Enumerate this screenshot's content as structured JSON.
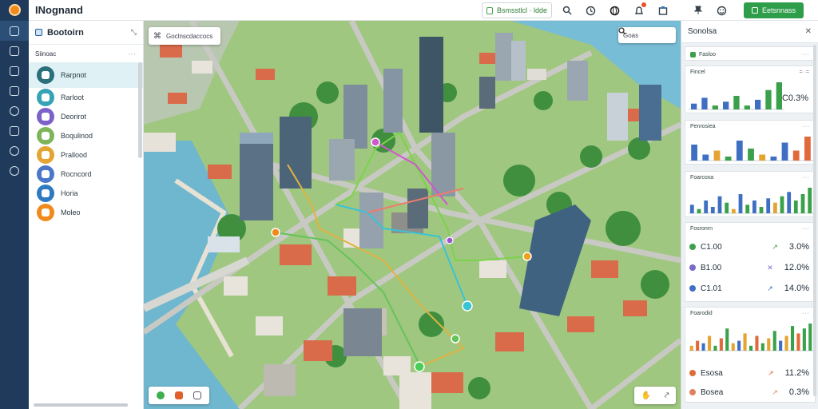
{
  "app": {
    "title": "INognand"
  },
  "topbar": {
    "search_label": "Bsmsstlcl · ldde",
    "cta_label": "Eetsnnass",
    "icons": [
      "search-icon",
      "history-icon",
      "globe-icon",
      "notification-icon",
      "share-icon",
      "pin-icon",
      "smiley-icon"
    ],
    "colors": {
      "brand": "#1f3a5a",
      "accent": "#f08a1c",
      "cta": "#2e9e4a"
    }
  },
  "rail": {
    "icons": [
      "edit-icon",
      "layers-icon",
      "document-icon",
      "files-icon",
      "analytics-icon",
      "tools-icon",
      "explore-icon",
      "info-icon"
    ]
  },
  "left_panel": {
    "title": "Bootoirn",
    "subtitle": "Siinoac",
    "more": "···",
    "layers": [
      {
        "label": "Rarpnot",
        "color": "#2a6f7c"
      },
      {
        "label": "Rarloot",
        "color": "#35a3b5"
      },
      {
        "label": "Deorirot",
        "color": "#7b61c9"
      },
      {
        "label": "Boqulinod",
        "color": "#7fb55a"
      },
      {
        "label": "Prallood",
        "color": "#e5a331"
      },
      {
        "label": "Rocncord",
        "color": "#4a77c9"
      },
      {
        "label": "Horia",
        "color": "#2d7ac0"
      },
      {
        "label": "Moleo",
        "color": "#f08a1c"
      }
    ]
  },
  "map": {
    "search_text": "Goclnscdaccocs",
    "search2_text": "Goas",
    "tool_icons": [
      "marker-green-icon",
      "marker-orange-icon",
      "comment-icon"
    ],
    "tool2_icons": [
      "pan-icon",
      "measure-icon"
    ]
  },
  "right_panel": {
    "title": "Sonolsa",
    "top_row": {
      "label": "Fasloo",
      "more": "···"
    },
    "cards": [
      {
        "title": "Fincel",
        "value": "C0.3%",
        "more": "=·="
      },
      {
        "title": "Penrosiea",
        "more": "···"
      },
      {
        "title": "Foarcoxa",
        "more": "···"
      },
      {
        "title": "Foaroadd",
        "more": "···"
      }
    ],
    "kpi_title": "Fosronrn",
    "kpi_more": "···",
    "kpis": [
      {
        "label": "C1.00",
        "value": "3.0%",
        "color": "#3aa14a"
      },
      {
        "label": "B1.00",
        "value": "12.0%",
        "color": "#7a6cc9"
      },
      {
        "label": "C1.01",
        "value": "14.0%",
        "color": "#3f6fc2"
      }
    ],
    "lower_title": "Foarodid",
    "lower_more": "···",
    "bottom_kpis": [
      {
        "label": "Esosa",
        "value": "11.2%",
        "color": "#e06a3a"
      },
      {
        "label": "Bosea",
        "value": "0.3%",
        "color": "#e08060"
      }
    ]
  },
  "chart_data": [
    {
      "type": "bar",
      "title": "Fincel",
      "values": [
        3,
        6,
        2,
        4,
        7,
        2,
        5,
        10,
        14
      ],
      "colors": [
        "#3f6fc2",
        "#3f6fc2",
        "#3aa14a",
        "#3f6fc2",
        "#3aa14a",
        "#3aa14a",
        "#3f6fc2",
        "#3aa14a",
        "#3aa14a"
      ]
    },
    {
      "type": "bar",
      "title": "Penrosiea",
      "values": [
        8,
        3,
        5,
        2,
        10,
        6,
        3,
        2,
        9,
        5,
        12
      ],
      "colors": [
        "#3f6fc2",
        "#3f6fc2",
        "#e5a331",
        "#3aa14a",
        "#3f6fc2",
        "#3aa14a",
        "#e5a331",
        "#3f6fc2",
        "#3f6fc2",
        "#e06a3a",
        "#e06a3a"
      ]
    },
    {
      "type": "bar",
      "title": "Foarcoxa",
      "values": [
        4,
        2,
        6,
        3,
        8,
        5,
        2,
        9,
        4,
        6,
        3,
        7,
        5,
        8,
        10,
        6,
        9,
        12
      ],
      "colors": [
        "#3f6fc2",
        "#3aa14a",
        "#3f6fc2",
        "#3f6fc2",
        "#3f6fc2",
        "#3aa14a",
        "#e5a331",
        "#3f6fc2",
        "#3aa14a",
        "#3f6fc2",
        "#3aa14a",
        "#3f6fc2",
        "#e5a331",
        "#3aa14a",
        "#3f6fc2",
        "#3aa14a",
        "#3aa14a",
        "#3aa14a"
      ]
    },
    {
      "type": "bar",
      "title": "Foarodid",
      "values": [
        2,
        4,
        3,
        6,
        2,
        5,
        9,
        3,
        4,
        7,
        2,
        6,
        3,
        5,
        8,
        4,
        6,
        10,
        7,
        9,
        11
      ],
      "colors": [
        "#e5a331",
        "#e06a3a",
        "#3f6fc2",
        "#e5a331",
        "#3aa14a",
        "#e06a3a",
        "#3aa14a",
        "#e5a331",
        "#3f6fc2",
        "#e5a331",
        "#3aa14a",
        "#e06a3a",
        "#3aa14a",
        "#e5a331",
        "#3aa14a",
        "#3f6fc2",
        "#e5a331",
        "#3aa14a",
        "#e06a3a",
        "#3aa14a",
        "#3aa14a"
      ]
    }
  ]
}
